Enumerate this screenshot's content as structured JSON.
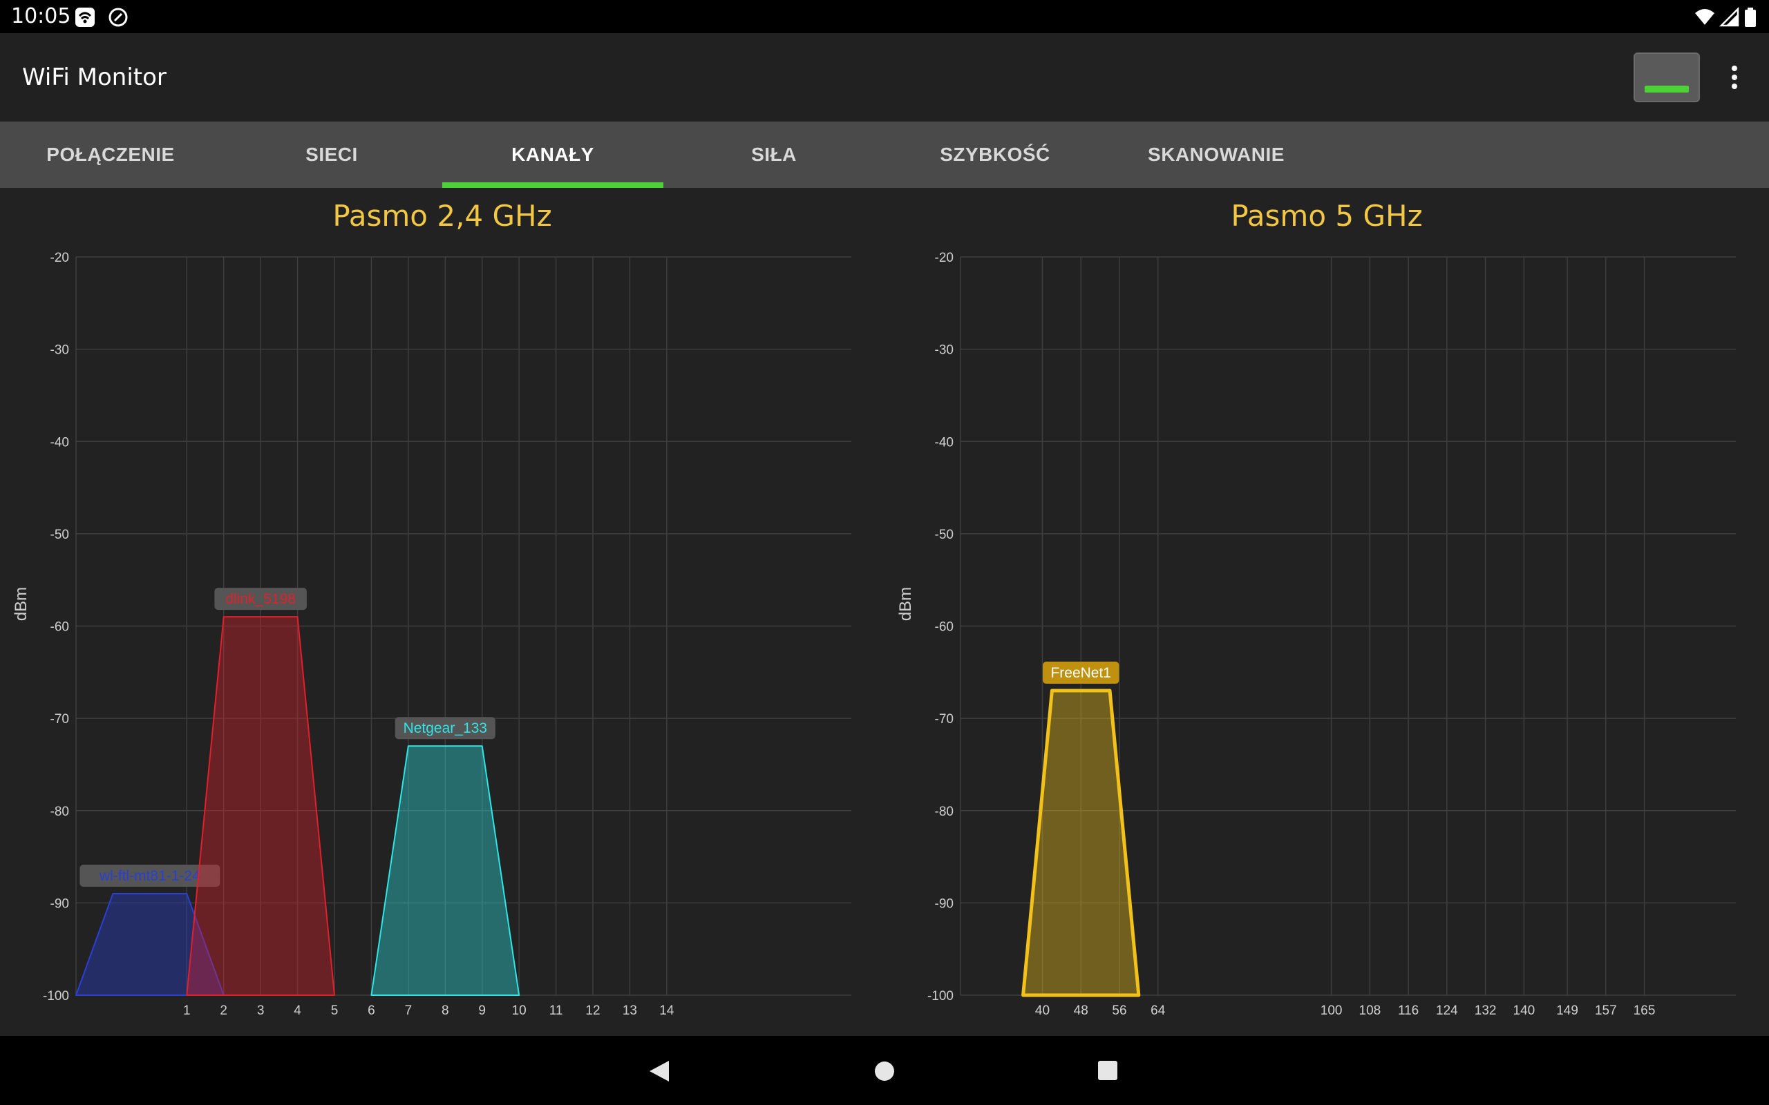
{
  "status": {
    "time": "10:05"
  },
  "app": {
    "title": "WiFi Monitor"
  },
  "tabs": [
    {
      "label": "POŁĄCZENIE"
    },
    {
      "label": "SIECI"
    },
    {
      "label": "KANAŁY"
    },
    {
      "label": "SIŁA"
    },
    {
      "label": "SZYBKOŚĆ"
    },
    {
      "label": "SKANOWANIE"
    }
  ],
  "active_tab": 2,
  "colors": {
    "accent": "#4cd137",
    "title": "#f2c744",
    "background": "#222222",
    "tabbar": "#4a4a4a"
  },
  "chart_data": [
    {
      "type": "area",
      "title": "Pasmo 2,4 GHz",
      "ylabel": "dBm",
      "xlabel": "",
      "ylim": [
        -100,
        -20
      ],
      "yticks": [
        -20,
        -30,
        -40,
        -50,
        -60,
        -70,
        -80,
        -90,
        -100
      ],
      "xlim": [
        -2,
        19
      ],
      "xticks": [
        "1",
        "2",
        "3",
        "4",
        "5",
        "6",
        "7",
        "8",
        "9",
        "10",
        "11",
        "12",
        "13",
        "14"
      ],
      "xtick_positions": [
        1,
        2,
        3,
        4,
        5,
        6,
        7,
        8,
        9,
        10,
        11,
        12,
        13,
        14
      ],
      "grid": true,
      "series": [
        {
          "name": "wl-ftl-mt81-1-24",
          "channel": 0,
          "signal": -89,
          "color": "#2a3fd4"
        },
        {
          "name": "dlink_5198",
          "channel": 3,
          "signal": -59,
          "color": "#e0202a"
        },
        {
          "name": "Netgear_133",
          "channel": 8,
          "signal": -73,
          "color": "#2ee6e6"
        }
      ]
    },
    {
      "type": "area",
      "title": "Pasmo 5 GHz",
      "ylabel": "dBm",
      "xlabel": "",
      "ylim": [
        -100,
        -20
      ],
      "yticks": [
        -20,
        -30,
        -40,
        -50,
        -60,
        -70,
        -80,
        -90,
        -100
      ],
      "xlim": [
        23,
        184
      ],
      "xticks": [
        "40",
        "48",
        "56",
        "64",
        "100",
        "108",
        "116",
        "124",
        "132",
        "140",
        "149",
        "157",
        "165"
      ],
      "xtick_positions": [
        40,
        48,
        56,
        64,
        100,
        108,
        116,
        124,
        132,
        140,
        149,
        157,
        165
      ],
      "grid": true,
      "series": [
        {
          "name": "FreeNet1",
          "channel": 48,
          "signal": -67,
          "color": "#f2c21a"
        }
      ]
    }
  ]
}
